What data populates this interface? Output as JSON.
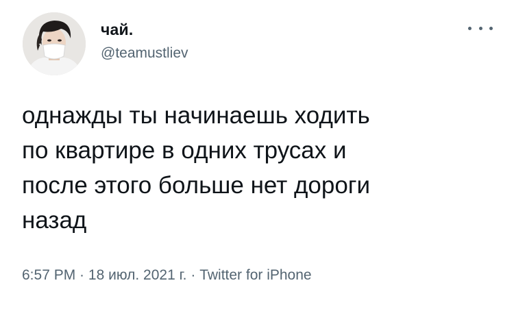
{
  "tweet": {
    "author_name": "чай.",
    "author_handle": "@teamustliev",
    "more_icon": "more-horizontal-icon",
    "text": "однажды ты начинаешь ходить\nпо квартире в одних трусах и\nпосле этого больше нет дороги\nназад",
    "time": "6:57 PM",
    "separator": " · ",
    "date": "18 июл. 2021 г.",
    "source": "Twitter for iPhone"
  },
  "colors": {
    "text_primary": "#0f1419",
    "text_secondary": "#536471",
    "background": "#ffffff"
  }
}
